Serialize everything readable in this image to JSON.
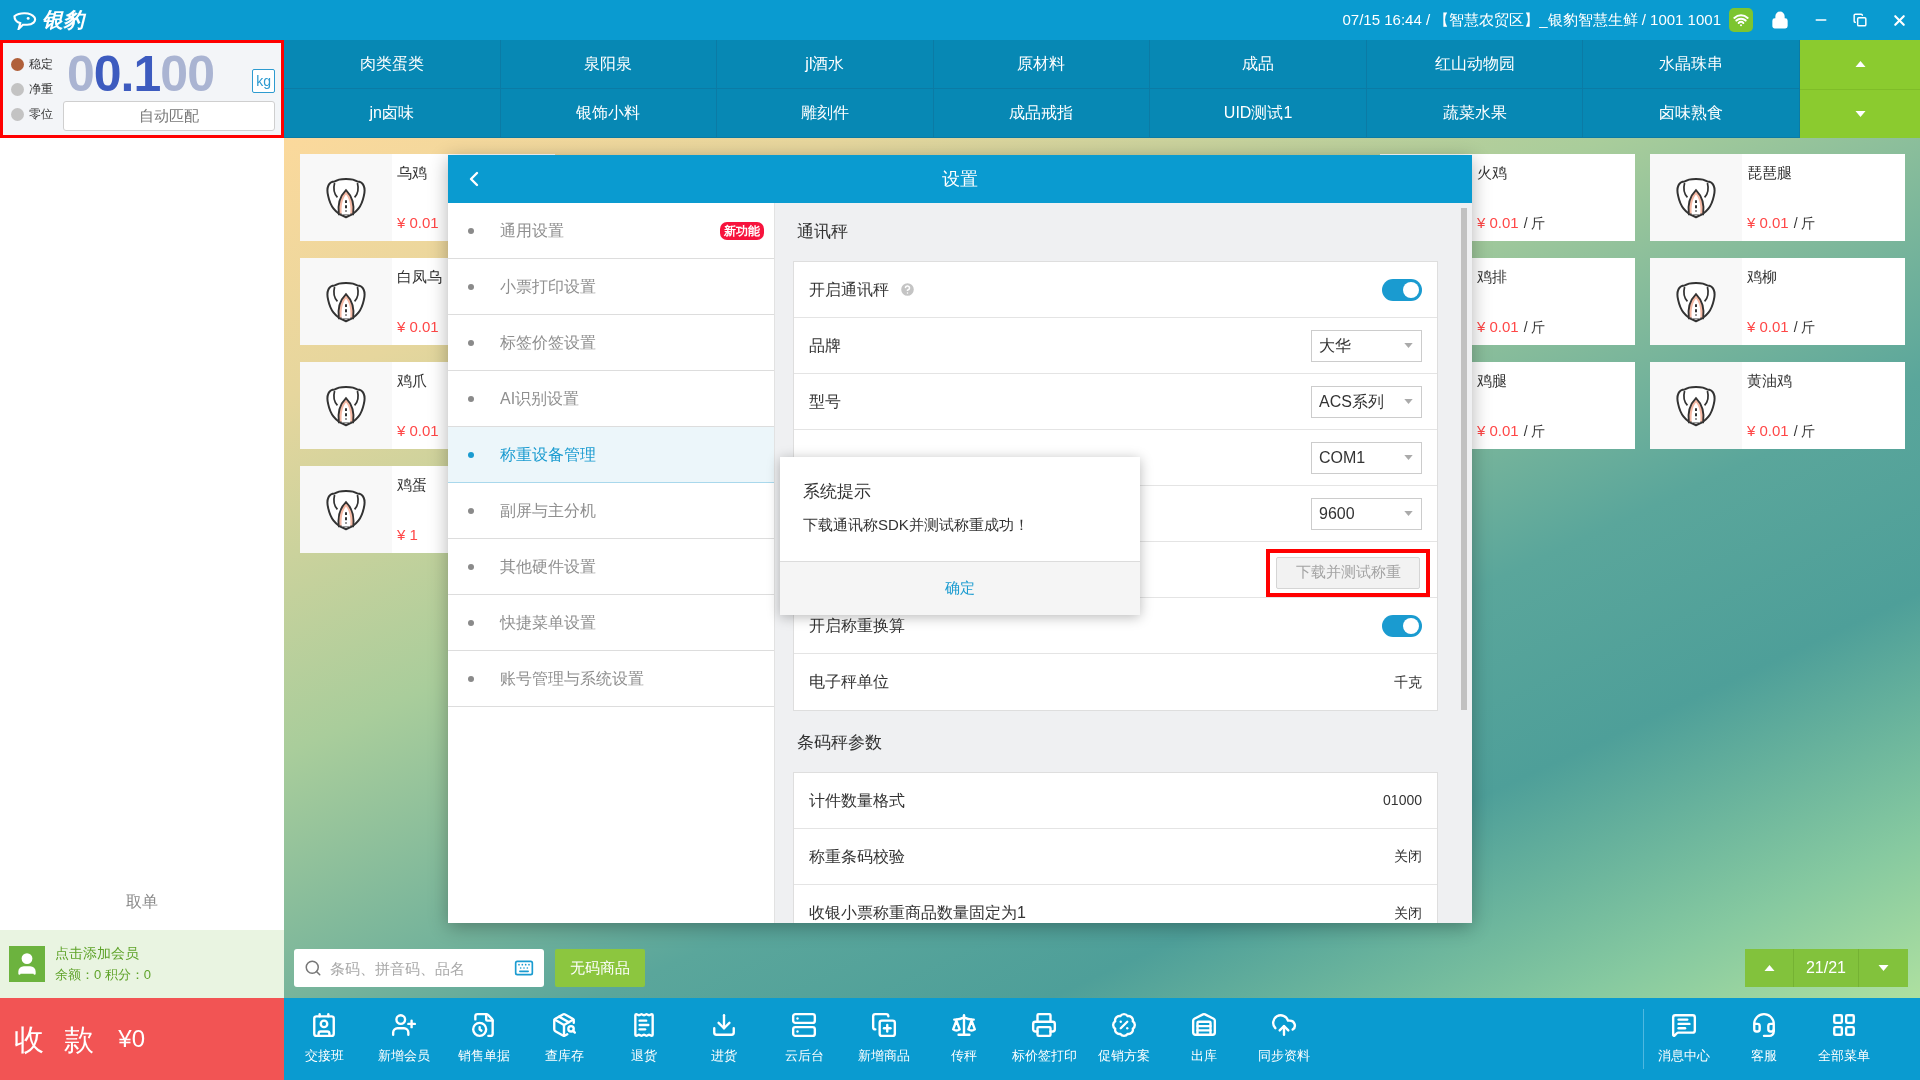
{
  "title_bar": {
    "logo": "银豹",
    "status": "07/15 16:44 / 【智慧农贸区】_银豹智慧生鲜 / 1001 1001"
  },
  "scale": {
    "highlighted": true,
    "indicators": [
      {
        "label": "稳定",
        "on": true
      },
      {
        "label": "净重",
        "on": false
      },
      {
        "label": "零位",
        "on": false
      }
    ],
    "reading": {
      "lead": "0",
      "value": "0.1",
      "trail": "00"
    },
    "unit": "kg",
    "match_button": "自动匹配"
  },
  "categories": [
    {
      "label": "肉类蛋类"
    },
    {
      "label": "泉阳泉"
    },
    {
      "label": "jl酒水"
    },
    {
      "label": "原材料"
    },
    {
      "label": "成品"
    },
    {
      "label": "红山动物园"
    },
    {
      "label": "水晶珠串"
    },
    {
      "label": "jn卤味"
    },
    {
      "label": "银饰小料"
    },
    {
      "label": "雕刻件"
    },
    {
      "label": "成品戒指"
    },
    {
      "label": "UID测试1"
    },
    {
      "label": "蔬菜水果"
    },
    {
      "label": "卤味熟食"
    }
  ],
  "left_panel": {
    "pickup": "取单",
    "member": {
      "title": "点击添加会员",
      "balance": "余额：0 积分：0"
    }
  },
  "product_columns": [
    {
      "items": [
        {
          "kind": "image",
          "name": "乌鸡",
          "price": "¥ 0.01"
        },
        {
          "kind": "image",
          "name": "白凤乌",
          "price": "¥ 0.01"
        },
        {
          "kind": "image",
          "name": "鸡爪",
          "price": "¥ 0.01"
        },
        {
          "kind": "image",
          "name": "鸡蛋",
          "price": "¥ 1"
        }
      ]
    },
    {
      "items": [
        {
          "kind": "text",
          "name": "火鸡",
          "price": "¥ 0.01",
          "unit": "/ 斤"
        },
        {
          "kind": "text",
          "name": "鸡排",
          "price": "¥ 0.01",
          "unit": "/ 斤"
        },
        {
          "kind": "text",
          "name": "鸡腿",
          "price": "¥ 0.01",
          "unit": "/ 斤"
        }
      ]
    },
    {
      "items": [
        {
          "kind": "image",
          "name": "琵琶腿",
          "price": "¥ 0.01",
          "unit": "/ 斤"
        },
        {
          "kind": "image",
          "name": "鸡柳",
          "price": "¥ 0.01",
          "unit": "/ 斤"
        },
        {
          "kind": "image",
          "name": "黄油鸡",
          "price": "¥ 0.01",
          "unit": "/ 斤"
        }
      ]
    }
  ],
  "settings": {
    "title": "设置",
    "menu": [
      {
        "label": "通用设置",
        "selected": false,
        "badge": "新功能"
      },
      {
        "label": "小票打印设置",
        "selected": false
      },
      {
        "label": "标签价签设置",
        "selected": false
      },
      {
        "label": "AI识别设置",
        "selected": false
      },
      {
        "label": "称重设备管理",
        "selected": true
      },
      {
        "label": "副屏与主分机",
        "selected": false
      },
      {
        "label": "其他硬件设置",
        "selected": false
      },
      {
        "label": "快捷菜单设置",
        "selected": false
      },
      {
        "label": "账号管理与系统设置",
        "selected": false
      }
    ],
    "sections": [
      {
        "title": "通讯秤",
        "rows": [
          {
            "kind": "toggle",
            "label": "开启通讯秤",
            "help": true,
            "on": true
          },
          {
            "kind": "select",
            "label": "品牌",
            "value": "大华"
          },
          {
            "kind": "select",
            "label": "型号",
            "value": "ACS系列"
          },
          {
            "kind": "select",
            "value": "COM1"
          },
          {
            "kind": "select",
            "value": "9600"
          },
          {
            "kind": "button",
            "button": "下载并测试称重",
            "disabled": true,
            "highlighted": true
          },
          {
            "kind": "toggle",
            "label": "开启称重换算",
            "on": true
          },
          {
            "kind": "value",
            "label": "电子秤单位",
            "value": "千克"
          }
        ]
      },
      {
        "title": "条码秤参数",
        "rows": [
          {
            "kind": "value",
            "label": "计件数量格式",
            "value": "01000"
          },
          {
            "kind": "value",
            "label": "称重条码校验",
            "value": "关闭"
          },
          {
            "kind": "value",
            "label": "收银小票称重商品数量固定为1",
            "value": "关闭"
          }
        ]
      }
    ]
  },
  "alert": {
    "title": "系统提示",
    "message": "下载通讯称SDK并测试称重成功！",
    "button": "确定"
  },
  "search": {
    "placeholder": "条码、拼音码、品名"
  },
  "no_code_button": "无码商品",
  "pager": {
    "label": "21/21"
  },
  "pay": {
    "label": "收 款",
    "amount": "¥0"
  },
  "toolbar": [
    {
      "label": "交接班"
    },
    {
      "label": "新增会员"
    },
    {
      "label": "销售单据"
    },
    {
      "label": "查库存"
    },
    {
      "label": "退货"
    },
    {
      "label": "进货"
    },
    {
      "label": "云后台"
    },
    {
      "label": "新增商品"
    },
    {
      "label": "传秤"
    },
    {
      "label": "标价签打印"
    },
    {
      "label": "促销方案"
    },
    {
      "label": "出库"
    },
    {
      "label": "同步资料"
    }
  ],
  "toolbar_right": [
    {
      "label": "消息中心"
    },
    {
      "label": "客服"
    },
    {
      "label": "全部菜单"
    }
  ]
}
